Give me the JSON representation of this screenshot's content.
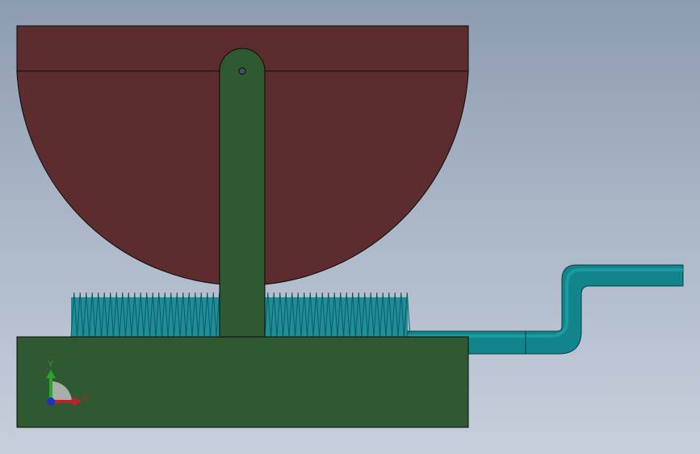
{
  "viewport": {
    "background_top": "#8d9cb0",
    "background_bottom": "#c7cfdc"
  },
  "colors": {
    "bowl_fill": "#5c2c2e",
    "arm_fill": "#2f5a31",
    "base_fill": "#2f5a31",
    "spring_fill": "#1e8e98",
    "spring_stroke": "#0f5a62",
    "pipe_fill": "#12858c",
    "pipe_highlight": "#1fa3aa",
    "outline": "#0a0a0a"
  },
  "triad": {
    "x_label": "X",
    "y_label": "Y",
    "x_color": "#c0202a",
    "y_color": "#2aa52a",
    "z_color": "#2030c0"
  }
}
